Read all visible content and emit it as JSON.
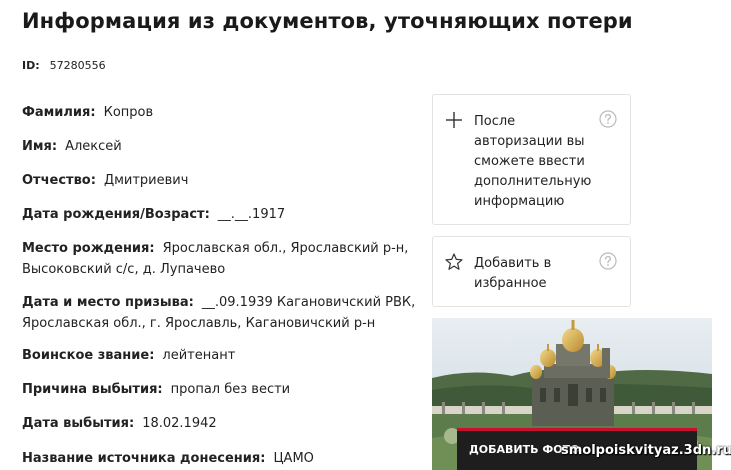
{
  "header": {
    "title": "Информация из документов, уточняющих потери"
  },
  "record": {
    "id_label": "ID:",
    "id_value": "57280556"
  },
  "fields": [
    {
      "label": "Фамилия",
      "value": "Копров"
    },
    {
      "label": "Имя",
      "value": "Алексей"
    },
    {
      "label": "Отчество",
      "value": "Дмитриевич"
    },
    {
      "label": "Дата рождения/Возраст",
      "value": "__.__.1917"
    },
    {
      "label": "Место рождения",
      "value": "Ярославская обл., Ярославский р-н, Высоковский с/с, д. Лупачево"
    },
    {
      "label": "Дата и место призыва",
      "value": "__.09.1939 Кагановичский РВК, Ярославская обл., г. Ярославль, Кагановичский р-н"
    },
    {
      "label": "Воинское звание",
      "value": "лейтенант"
    },
    {
      "label": "Причина выбытия",
      "value": "пропал без вести"
    },
    {
      "label": "Дата выбытия",
      "value": "18.02.1942"
    },
    {
      "label": "Название источника донесения",
      "value": "ЦАМО"
    }
  ],
  "sidebar": {
    "auth_card": {
      "icon": "plus-icon",
      "text": "После авторизации вы сможете ввести дополнительную информацию",
      "help_icon": "question-circle-icon"
    },
    "favorite_card": {
      "icon": "star-outline-icon",
      "text": "Добавить в избранное",
      "help_icon": "question-circle-icon"
    },
    "banner": {
      "button_text": "ДОБАВИТЬ ФОТО"
    }
  },
  "overlay": {
    "watermark": "smolpoiskvityaz.3dn.ru"
  },
  "colors": {
    "banner_accent": "#c8102e",
    "banner_button_bg": "#1e1e1e",
    "card_border": "#e3e3e3",
    "help_icon": "#bbbbbb"
  }
}
